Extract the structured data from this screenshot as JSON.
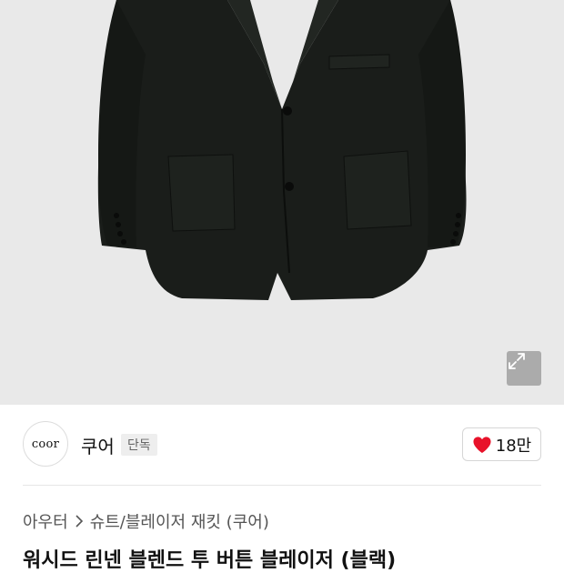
{
  "product_image": {
    "description_icon": "blazer-photo",
    "background_color": "#e9e9e9"
  },
  "expand_icon": "expand-icon",
  "brand": {
    "logo_text": "coor",
    "name": "쿠어",
    "badge": "단독"
  },
  "like": {
    "icon": "heart-icon",
    "count": "18만",
    "heart_color": "#e8122a"
  },
  "breadcrumb": {
    "category": "아우터",
    "separator_icon": "chevron-right-icon",
    "subcategory": "슈트/블레이저 재킷 (쿠어)"
  },
  "product": {
    "title": "워시드 린넨 블렌드 투 버튼 블레이저 (블랙)"
  }
}
